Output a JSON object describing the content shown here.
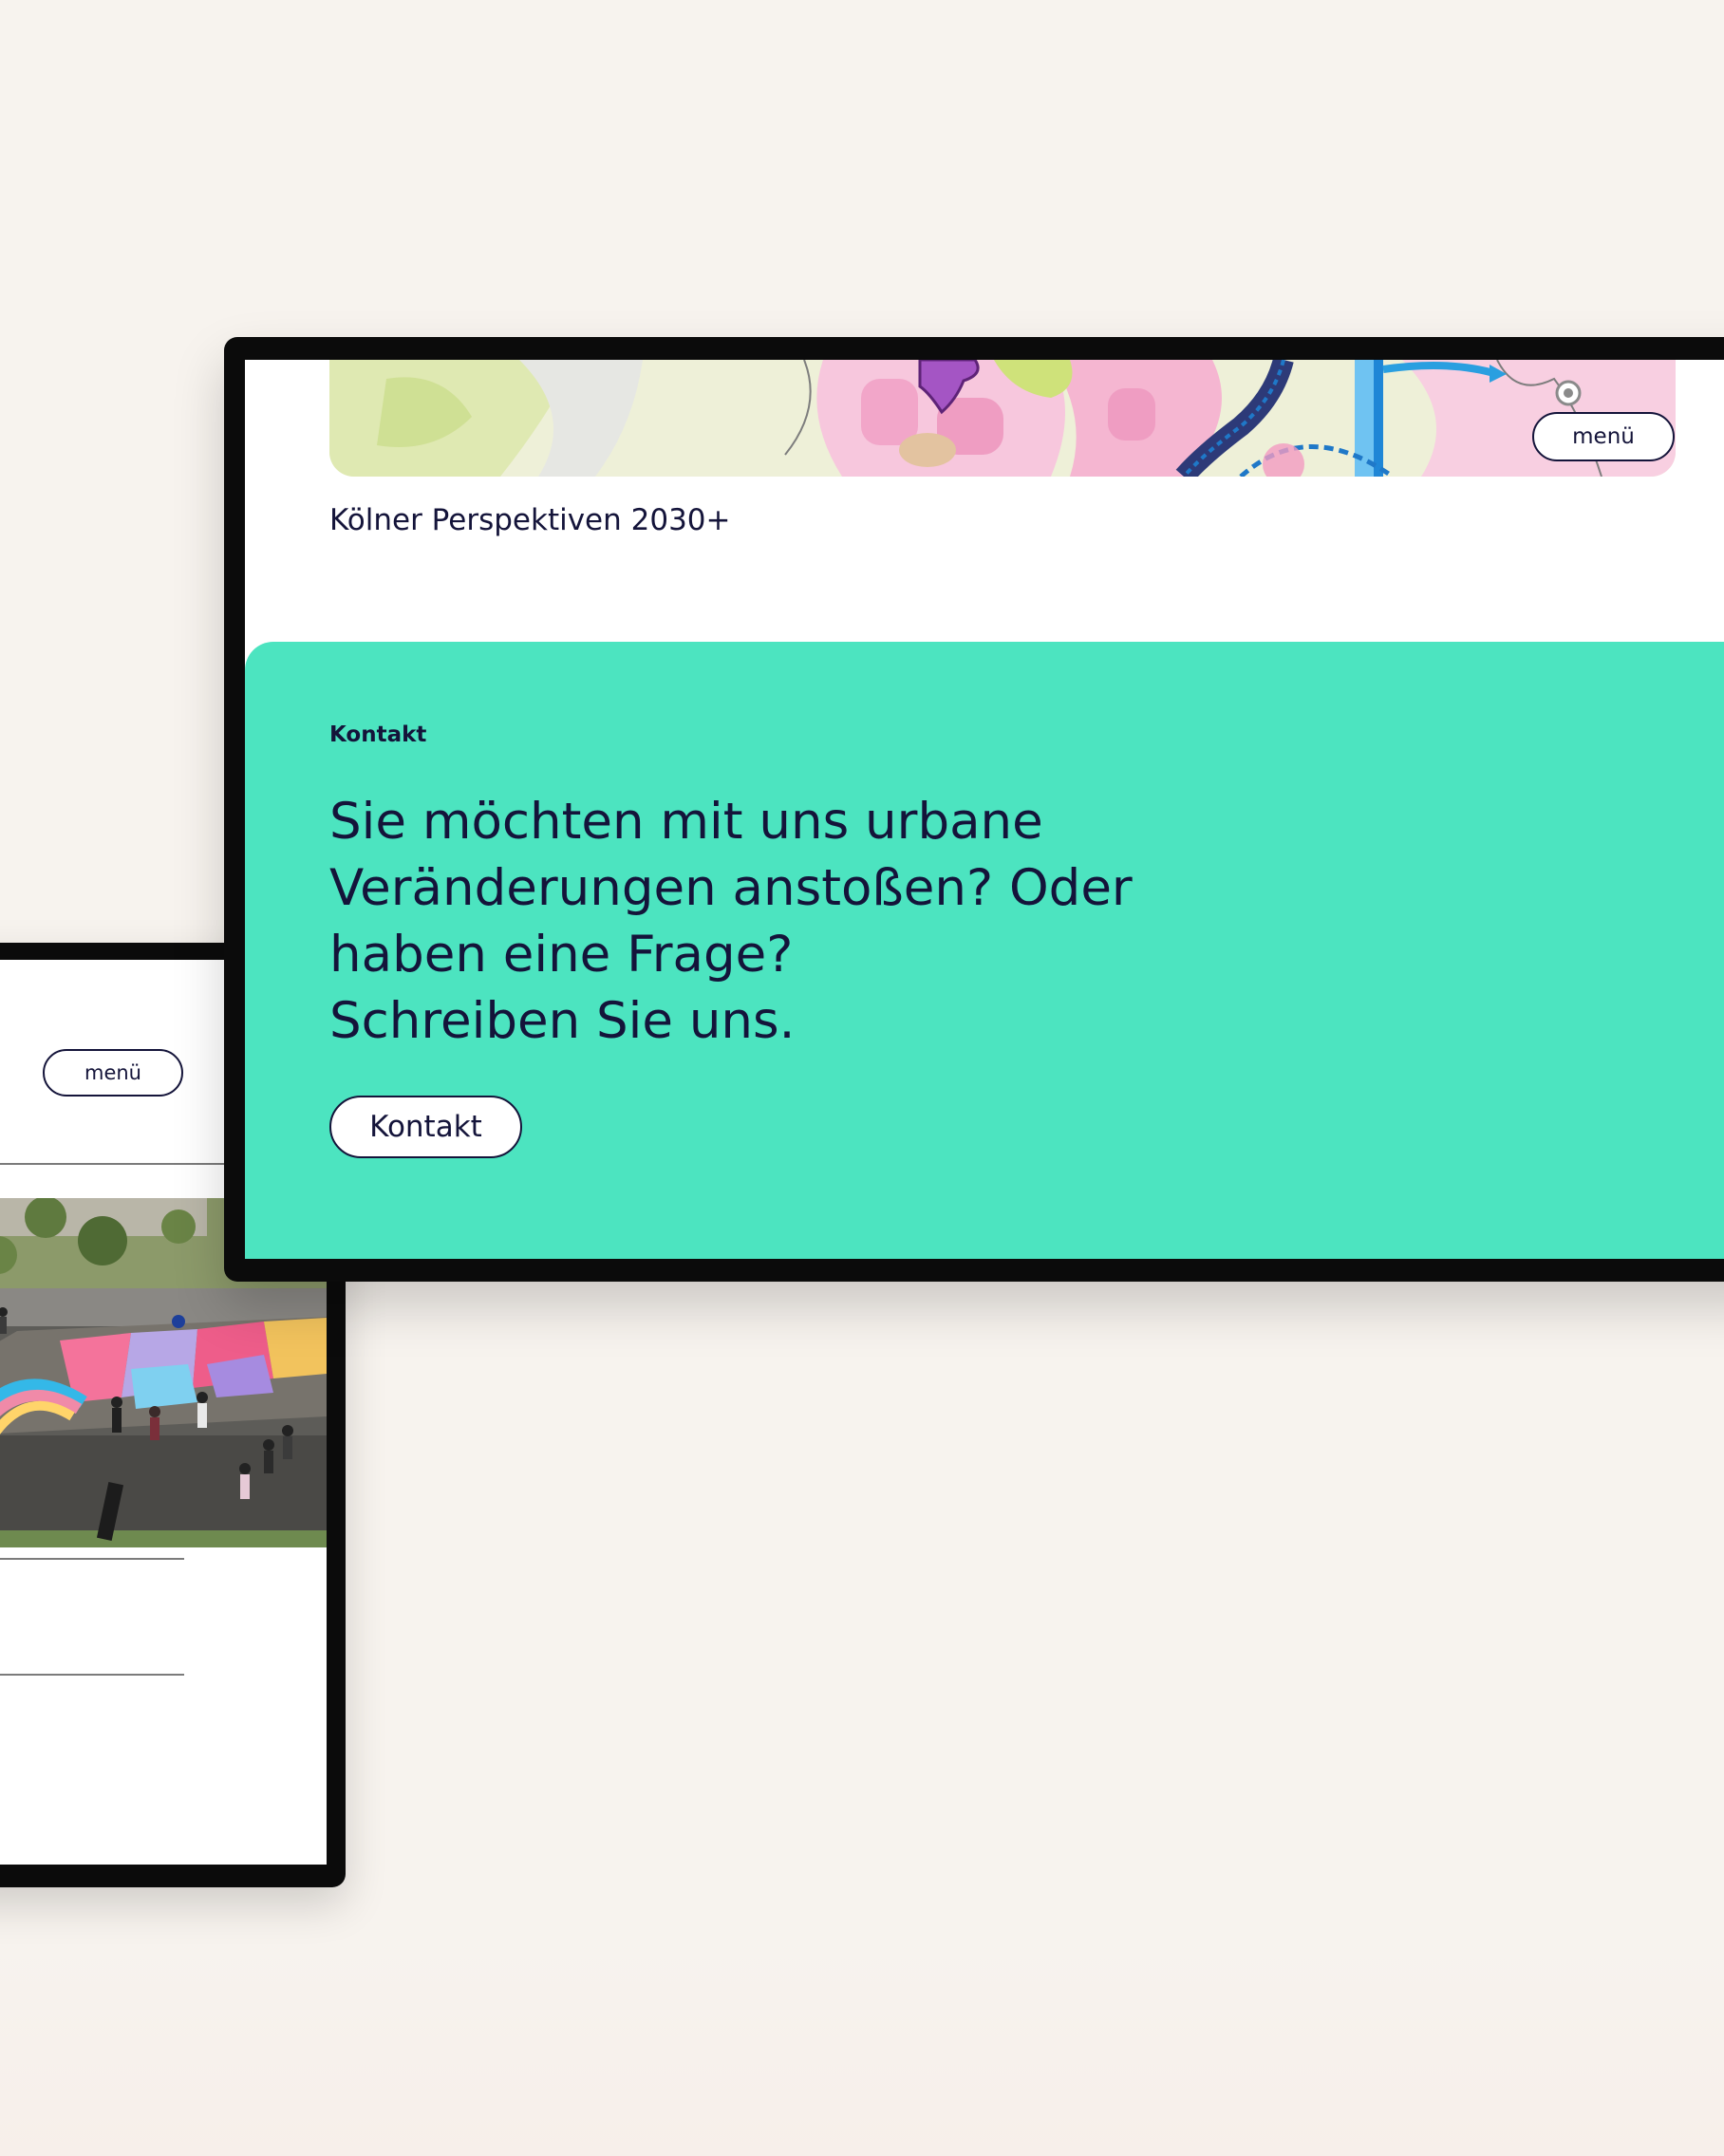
{
  "desktop": {
    "site_title": "Kölner Perspektiven 2030+",
    "menu_label": "menü",
    "contact_section": {
      "eyebrow": "Kontakt",
      "headline_lines": [
        "Sie möchten mit uns urbane",
        "Veränderungen anstoßen? Oder",
        "haben eine Frage?",
        "Schreiben Sie uns."
      ],
      "button_label": "Kontakt",
      "background_color": "#4ce4c0"
    }
  },
  "mobile": {
    "menu_label": "menü"
  },
  "colors": {
    "page_background": "#f7f3ee",
    "text": "#14143a",
    "device_frame": "#0b0b0b"
  }
}
